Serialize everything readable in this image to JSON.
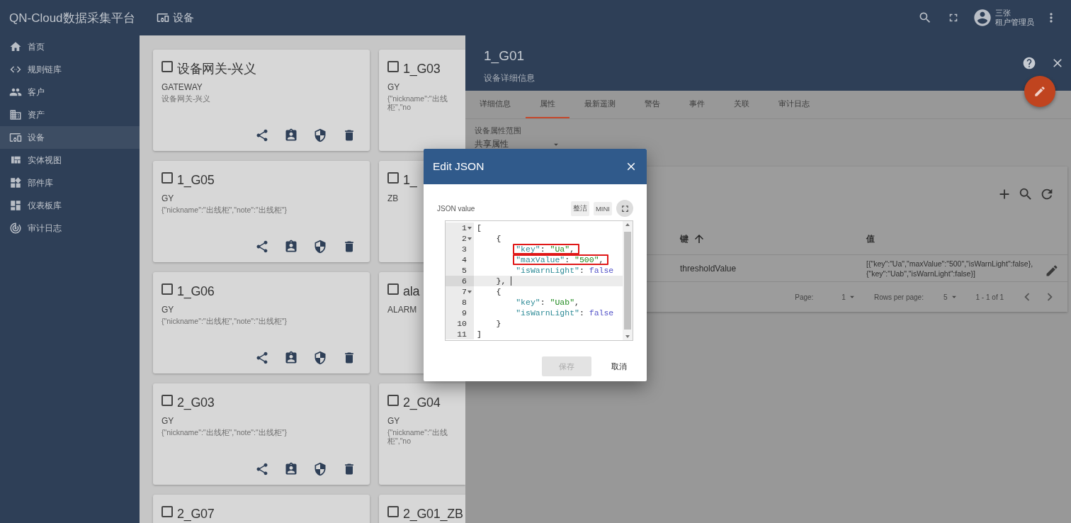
{
  "app": {
    "title": "QN-Cloud数据采集平台"
  },
  "sidebar": {
    "items": [
      {
        "label": "首页",
        "selected": false
      },
      {
        "label": "规则链库",
        "selected": false
      },
      {
        "label": "客户",
        "selected": false
      },
      {
        "label": "资产",
        "selected": false
      },
      {
        "label": "设备",
        "selected": true
      },
      {
        "label": "实体视图",
        "selected": false
      },
      {
        "label": "部件库",
        "selected": false
      },
      {
        "label": "仪表板库",
        "selected": false
      },
      {
        "label": "审计日志",
        "selected": false
      }
    ]
  },
  "top_bar": {
    "title": "设备",
    "user": {
      "name": "三张",
      "role": "租户管理员"
    }
  },
  "device_cards": [
    {
      "name": "设备网关-兴义",
      "type": "GATEWAY",
      "description": "设备网关-兴义",
      "checked": false,
      "actions_visible": true
    },
    {
      "name": "1_G03",
      "type": "GY",
      "description": "{\"nickname\":\"出线柜\",\"no",
      "checked": false,
      "actions_visible": false
    },
    {
      "name": "1_G05",
      "type": "GY",
      "description": "{\"nickname\":\"出线柜\",\"note\":\"出线柜\"}",
      "checked": false,
      "actions_visible": true
    },
    {
      "name": "1_",
      "type": "ZB",
      "checked": false,
      "actions_visible": false
    },
    {
      "name": "1_G06",
      "type": "GY",
      "description": "{\"nickname\":\"出线柜\",\"note\":\"出线柜\"}",
      "checked": false,
      "actions_visible": true
    },
    {
      "name": "ala",
      "type": "ALARM",
      "checked": false,
      "actions_visible": false
    },
    {
      "name": "2_G03",
      "type": "GY",
      "description": "{\"nickname\":\"出线柜\",\"note\":\"出线柜\"}",
      "checked": false,
      "actions_visible": true
    },
    {
      "name": "2_G04",
      "type": "GY",
      "description": "{\"nickname\":\"出线柜\",\"no",
      "checked": false,
      "actions_visible": false
    },
    {
      "name": "2_G07",
      "checked": false
    },
    {
      "name": "2_G01_ZB",
      "checked": false
    }
  ],
  "detail_panel": {
    "title": "1_G01",
    "subtitle": "设备详细信息",
    "tabs": [
      {
        "label": "详细信息",
        "selected": false
      },
      {
        "label": "属性",
        "selected": true
      },
      {
        "label": "最新遥测",
        "selected": false
      },
      {
        "label": "警告",
        "selected": false
      },
      {
        "label": "事件",
        "selected": false
      },
      {
        "label": "关联",
        "selected": false
      },
      {
        "label": "审计日志",
        "selected": false
      }
    ],
    "attribute_scope": {
      "label": "设备属性范围",
      "value": "共享属性"
    },
    "table": {
      "columns": [
        {
          "label": "键",
          "sorted": true
        },
        {
          "label": "值",
          "sorted": false
        }
      ],
      "rows": [
        {
          "key": "thresholdValue",
          "value": "[{\"key\":\"Ua\",\"maxValue\":\"500\",\"isWarnLight\":false},\n{\"key\":\"Uab\",\"isWarnLight\":false}]"
        }
      ],
      "pagination": {
        "page_label": "Page:",
        "page": "1",
        "rows_label": "Rows per page:",
        "rows": "5",
        "range": "1 - 1 of 1"
      }
    }
  },
  "dialog": {
    "title": "Edit JSON",
    "field_label": "JSON value",
    "tools": [
      "整洁",
      "MINI"
    ],
    "lines": [
      {
        "number": "1",
        "text": "[",
        "foldable": true,
        "active": false,
        "highlighted": false
      },
      {
        "number": "2",
        "text": "    {",
        "foldable": true,
        "active": false,
        "highlighted": false
      },
      {
        "number": "3",
        "text": "        \"key\": \"Ua\",",
        "foldable": false,
        "active": false,
        "highlighted": true
      },
      {
        "number": "4",
        "text": "        \"maxValue\": \"500\",",
        "foldable": false,
        "active": false,
        "highlighted": true
      },
      {
        "number": "5",
        "text": "        \"isWarnLight\": false",
        "foldable": false,
        "active": false,
        "highlighted": false
      },
      {
        "number": "6",
        "text": "    },",
        "foldable": false,
        "active": true,
        "highlighted": false
      },
      {
        "number": "7",
        "text": "    {",
        "foldable": true,
        "active": false,
        "highlighted": false
      },
      {
        "number": "8",
        "text": "        \"key\": \"Uab\",",
        "foldable": false,
        "active": false,
        "highlighted": false
      },
      {
        "number": "9",
        "text": "        \"isWarnLight\": false",
        "foldable": false,
        "active": false,
        "highlighted": false
      },
      {
        "number": "10",
        "text": "    }",
        "foldable": false,
        "active": false,
        "highlighted": false
      },
      {
        "number": "11",
        "text": "]",
        "foldable": false,
        "active": false,
        "highlighted": false
      }
    ],
    "buttons": [
      {
        "label": "保存",
        "disabled": true
      },
      {
        "label": "取消",
        "disabled": false
      }
    ]
  }
}
